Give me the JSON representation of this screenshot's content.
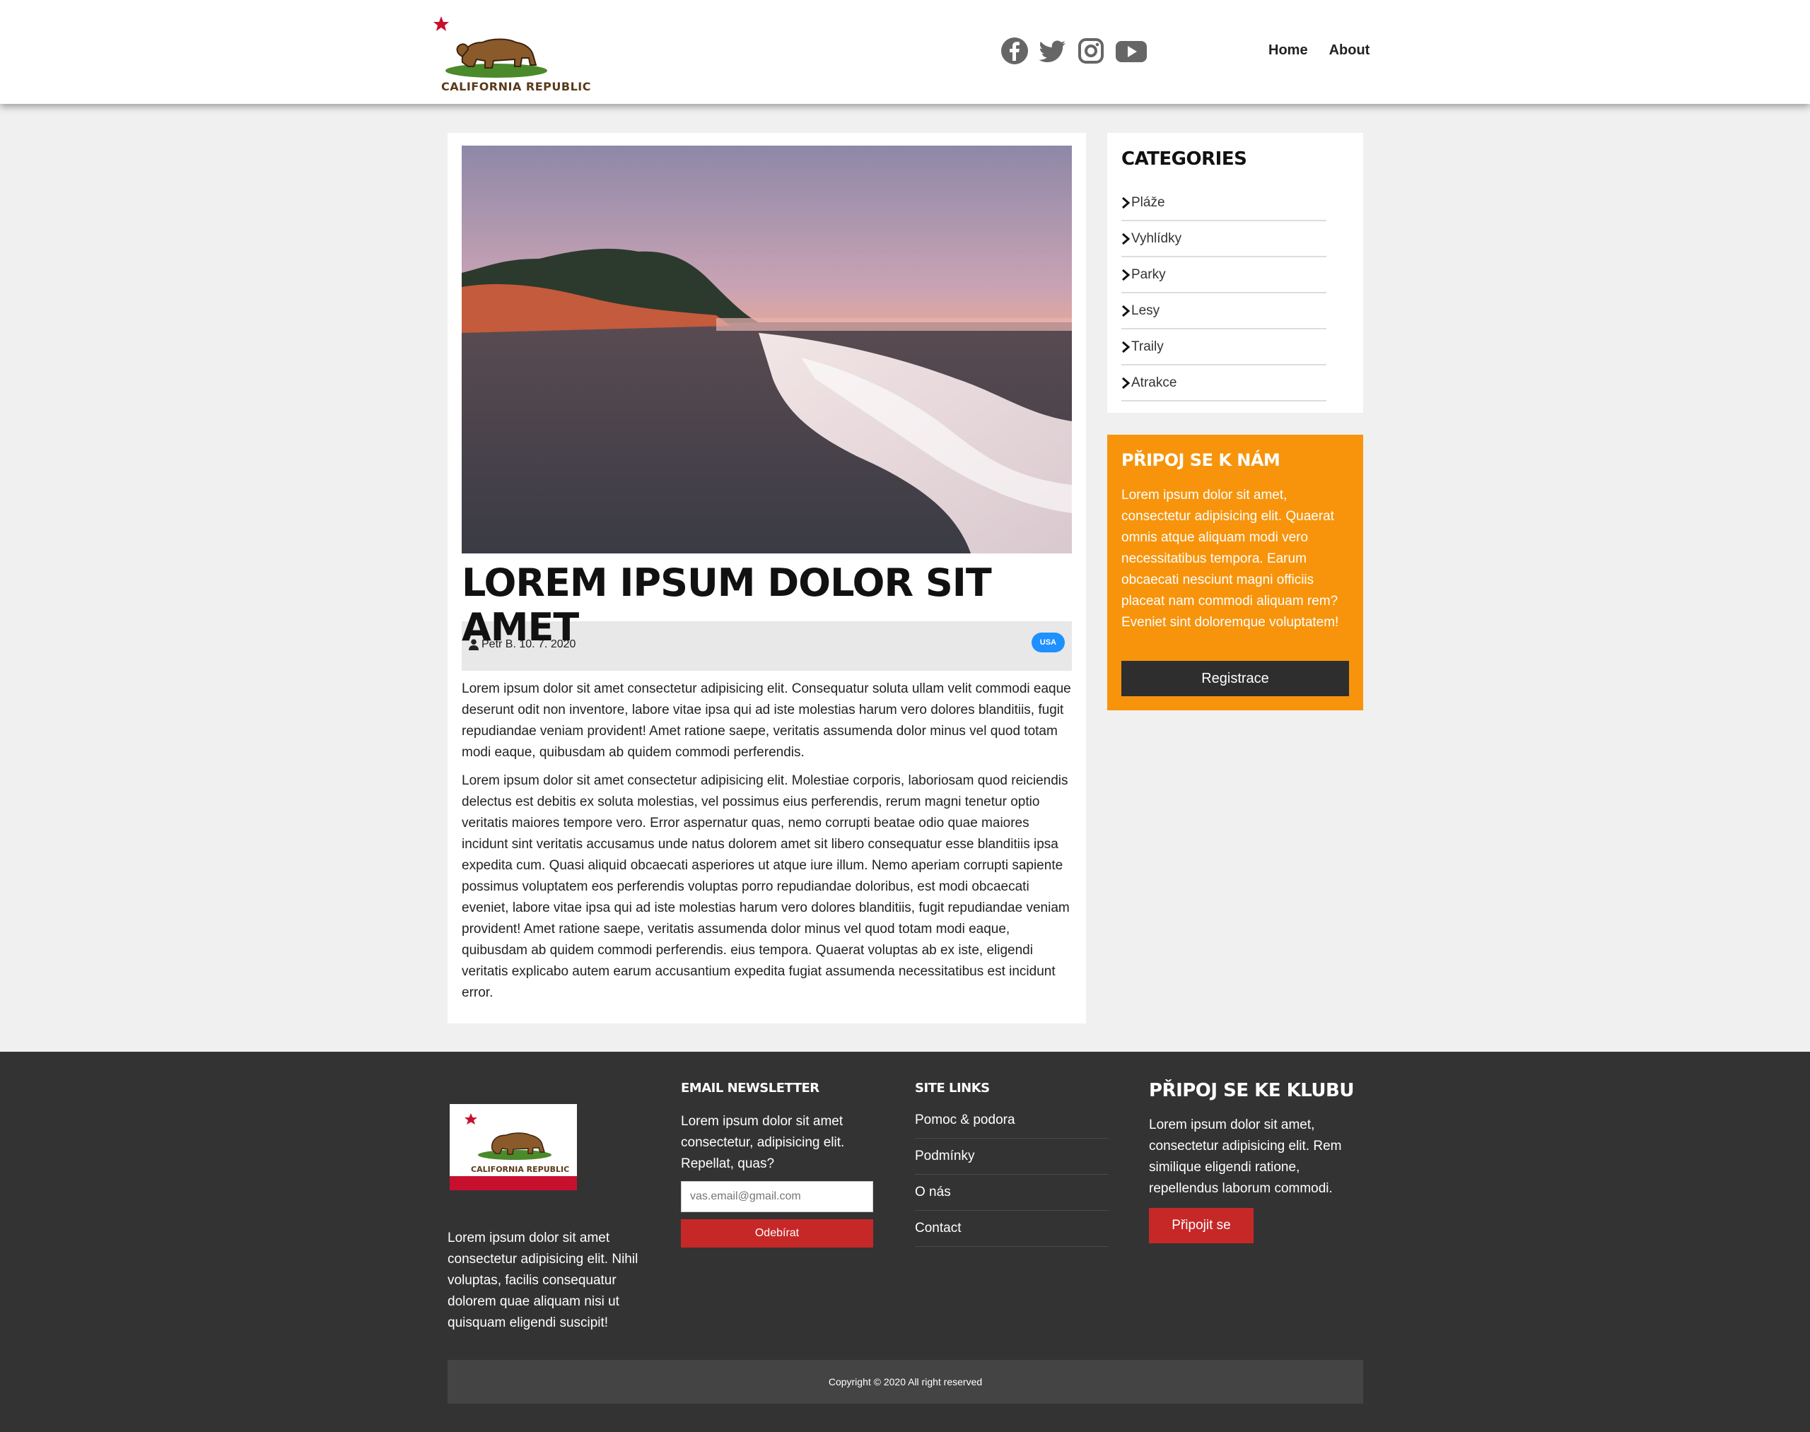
{
  "header": {
    "logo_text": "CALIFORNIA REPUBLIC",
    "social_icons": [
      "facebook-icon",
      "twitter-icon",
      "instagram-icon",
      "youtube-icon"
    ],
    "nav": [
      "Home",
      "About"
    ]
  },
  "article": {
    "title": "LOREM IPSUM DOLOR SIT AMET",
    "author_date": "Petr B. 10. 7. 2020",
    "tag": "USA",
    "paragraphs": [
      "Lorem ipsum dolor sit amet consectetur adipisicing elit. Consequatur soluta ullam velit commodi eaque deserunt odit non inventore, labore vitae ipsa qui ad iste molestias harum vero dolores blanditiis, fugit repudiandae veniam provident! Amet ratione saepe, veritatis assumenda dolor minus vel quod totam modi eaque, quibusdam ab quidem commodi perferendis.",
      "Lorem ipsum dolor sit amet consectetur adipisicing elit. Molestiae corporis, laboriosam quod reiciendis delectus est debitis ex soluta molestias, vel possimus eius perferendis, rerum magni tenetur optio veritatis maiores tempore vero. Error aspernatur quas, nemo corrupti beatae odio quae maiores incidunt sint veritatis accusamus unde natus dolorem amet sit libero consequatur esse blanditiis ipsa expedita cum. Quasi aliquid obcaecati asperiores ut atque iure illum. Nemo aperiam corrupti sapiente possimus voluptatem eos perferendis voluptas porro repudiandae doloribus, est modi obcaecati eveniet, labore vitae ipsa qui ad iste molestias harum vero dolores blanditiis, fugit repudiandae veniam provident! Amet ratione saepe, veritatis assumenda dolor minus vel quod totam modi eaque, quibusdam ab quidem commodi perferendis. eius tempora. Quaerat voluptas ab ex iste, eligendi veritatis explicabo autem earum accusantium expedita fugiat assumenda necessitatibus est incidunt error."
    ]
  },
  "sidebar": {
    "categories_title": "CATEGORIES",
    "categories": [
      "Pláže",
      "Vyhlídky",
      "Parky",
      "Lesy",
      "Traily",
      "Atrakce"
    ],
    "join_title": "PŘIPOJ SE K NÁM",
    "join_text": "Lorem ipsum dolor sit amet, consectetur adipisicing elit. Quaerat omnis atque aliquam modi vero necessitatibus tempora. Earum obcaecati nesciunt magni officiis placeat nam commodi aliquam rem? Eveniet sint doloremque voluptatem!",
    "join_button": "Registrace"
  },
  "footer": {
    "logo_text": "CALIFORNIA REPUBLIC",
    "about_text": "Lorem ipsum dolor sit amet consectetur adipisicing elit. Nihil voluptas, facilis consequatur dolorem quae aliquam nisi ut quisquam eligendi suscipit!",
    "newsletter_title": "EMAIL NEWSLETTER",
    "newsletter_text": "Lorem ipsum dolor sit amet consectetur, adipisicing elit. Repellat, quas?",
    "email_placeholder": "vas.email@gmail.com",
    "subscribe_button": "Odebírat",
    "links_title": "SITE LINKS",
    "links": [
      "Pomoc & podora",
      "Podmínky",
      "O nás",
      "Contact"
    ],
    "club_title": "PŘIPOJ SE KE KLUBU",
    "club_text": "Lorem ipsum dolor sit amet, consectetur adipisicing elit. Rem similique eligendi ratione, repellendus laborum commodi.",
    "club_button": "Připojit se",
    "copyright": "Copyright © 2020 All right reserved"
  },
  "colors": {
    "accent_orange": "#f7940c",
    "accent_red": "#c62828",
    "badge_blue": "#1e90ff",
    "footer_bg": "#333333"
  }
}
